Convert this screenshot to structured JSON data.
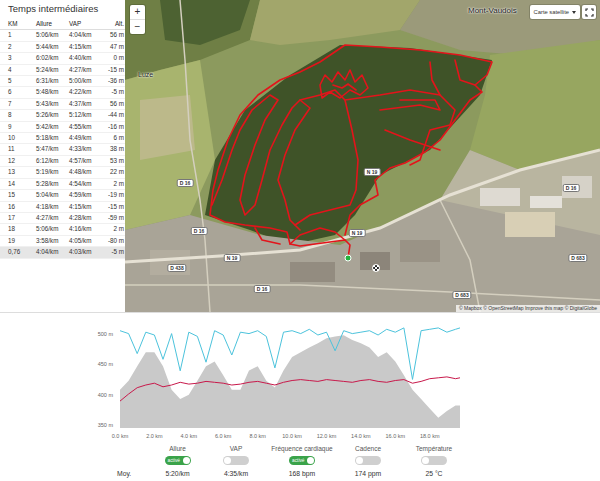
{
  "splits": {
    "title": "Temps intermédiaires",
    "columns": [
      "KM",
      "Allure",
      "VAP",
      "Alt."
    ],
    "rows": [
      {
        "cells": [
          "1",
          "5:06/km",
          "4:04/km",
          "56 m"
        ],
        "selected": false
      },
      {
        "cells": [
          "2",
          "5:44/km",
          "4:15/km",
          "47 m"
        ],
        "selected": false
      },
      {
        "cells": [
          "3",
          "6:02/km",
          "4:40/km",
          "0 m"
        ],
        "selected": false
      },
      {
        "cells": [
          "4",
          "5:24/km",
          "4:27/km",
          "-15 m"
        ],
        "selected": false
      },
      {
        "cells": [
          "5",
          "6:31/km",
          "5:00/km",
          "-36 m"
        ],
        "selected": false
      },
      {
        "cells": [
          "6",
          "5:48/km",
          "4:22/km",
          "-5 m"
        ],
        "selected": false
      },
      {
        "cells": [
          "7",
          "5:43/km",
          "4:37/km",
          "56 m"
        ],
        "selected": false
      },
      {
        "cells": [
          "8",
          "5:26/km",
          "5:12/km",
          "-44 m"
        ],
        "selected": false
      },
      {
        "cells": [
          "9",
          "5:42/km",
          "4:55/km",
          "-16 m"
        ],
        "selected": false
      },
      {
        "cells": [
          "10",
          "5:18/km",
          "4:49/km",
          "6 m"
        ],
        "selected": false
      },
      {
        "cells": [
          "11",
          "5:47/km",
          "4:33/km",
          "38 m"
        ],
        "selected": false
      },
      {
        "cells": [
          "12",
          "6:12/km",
          "4:57/km",
          "53 m"
        ],
        "selected": false
      },
      {
        "cells": [
          "13",
          "5:19/km",
          "4:48/km",
          "22 m"
        ],
        "selected": false
      },
      {
        "cells": [
          "14",
          "5:28/km",
          "4:54/km",
          "2 m"
        ],
        "selected": false
      },
      {
        "cells": [
          "15",
          "5:04/km",
          "4:59/km",
          "-19 m"
        ],
        "selected": false
      },
      {
        "cells": [
          "16",
          "4:18/km",
          "4:15/km",
          "-15 m"
        ],
        "selected": false
      },
      {
        "cells": [
          "17",
          "4:27/km",
          "4:28/km",
          "-59 m"
        ],
        "selected": false
      },
      {
        "cells": [
          "18",
          "5:06/km",
          "4:16/km",
          "2 m"
        ],
        "selected": false
      },
      {
        "cells": [
          "19",
          "3:58/km",
          "4:05/km",
          "-80 m"
        ],
        "selected": false
      },
      {
        "cells": [
          "0,76",
          "4:04/km",
          "4:03/km",
          "-5 m"
        ],
        "selected": true
      }
    ]
  },
  "map": {
    "type_button": "Carte satellite",
    "zoom_in": "+",
    "zoom_out": "−",
    "place_labels": [
      "Mont-Vaudois",
      "Luze"
    ],
    "road_labels": [
      "D 16",
      "N 19",
      "N 19",
      "N 19",
      "D 438",
      "D 16",
      "D 683",
      "D 16",
      "D 683",
      "D 16"
    ],
    "attribution": "© Mapbox © OpenStreetMap Improve this map © DigitalGlobe"
  },
  "chart": {
    "y_ticks": [
      "500 m",
      "450 m",
      "400 m",
      "350 m"
    ],
    "x_ticks": [
      "0.0 km",
      "2.0 km",
      "4.0 km",
      "6.0 km",
      "8.0 km",
      "10.0 km",
      "12.0 km",
      "14.0 km",
      "16.0 km",
      "18.0 km"
    ],
    "distance_km": [
      0,
      0.5,
      1,
      1.5,
      2,
      2.5,
      3,
      3.5,
      4,
      4.5,
      5,
      5.5,
      6,
      6.5,
      7,
      7.5,
      8,
      8.5,
      9,
      9.5,
      10,
      10.5,
      11,
      11.5,
      12,
      12.5,
      13,
      13.5,
      14,
      14.5,
      15,
      15.5,
      16,
      16.5,
      17,
      17.5,
      18,
      18.5,
      19,
      19.5,
      19.76
    ],
    "elevation": [
      408,
      423,
      447,
      470,
      470,
      447,
      408,
      393,
      400,
      423,
      447,
      455,
      432,
      408,
      408,
      440,
      447,
      423,
      412,
      440,
      462,
      470,
      478,
      485,
      493,
      496,
      498,
      490,
      485,
      478,
      462,
      470,
      455,
      432,
      408,
      393,
      377,
      362,
      373,
      382,
      382
    ],
    "series": [
      {
        "name": "pace",
        "color": "#4cc3dc",
        "values": [
          5.2,
          5.4,
          6.8,
          5.3,
          5.5,
          7.2,
          5.4,
          8.0,
          5.3,
          5.6,
          7.4,
          5.2,
          5.5,
          6.9,
          5.3,
          5.4,
          5.2,
          5.6,
          7.8,
          5.3,
          5.2,
          5.4,
          5.1,
          5.5,
          5.3,
          6.6,
          5.2,
          5.4,
          5.3,
          5.2,
          5.5,
          5.1,
          5.3,
          5.0,
          8.6,
          5.2,
          5.1,
          5.0,
          5.3,
          5.1,
          5.0
        ]
      },
      {
        "name": "heart_rate",
        "color": "#c8194b",
        "values": [
          150,
          158,
          165,
          168,
          170,
          166,
          168,
          171,
          169,
          170,
          172,
          171,
          170,
          168,
          169,
          171,
          172,
          170,
          168,
          171,
          173,
          174,
          173,
          172,
          174,
          173,
          172,
          171,
          173,
          174,
          172,
          171,
          173,
          174,
          170,
          172,
          175,
          176,
          177,
          175,
          176
        ]
      }
    ]
  },
  "legend": [
    {
      "label": "Allure",
      "on": true,
      "toggle_text": "activé"
    },
    {
      "label": "VAP",
      "on": false
    },
    {
      "label": "Fréquence cardiaque",
      "on": true,
      "toggle_text": "activé"
    },
    {
      "label": "Cadence",
      "on": false
    },
    {
      "label": "Température",
      "on": false
    }
  ],
  "averages": {
    "label": "Moy.",
    "values": [
      "5:20/km",
      "4:35/km",
      "168 bpm",
      "174 ppm",
      "25 °C"
    ]
  }
}
